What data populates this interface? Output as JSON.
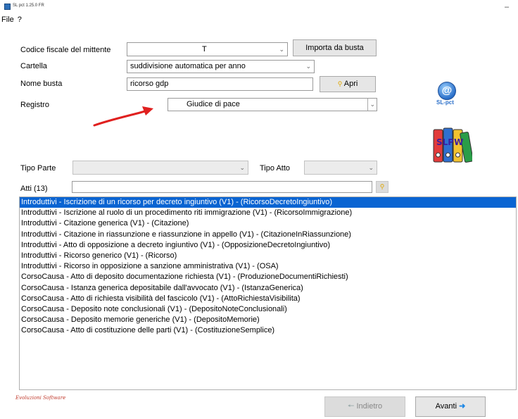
{
  "window": {
    "title": "SL pct 1.25.0 FR",
    "minimize": "–"
  },
  "menu": {
    "file": "File",
    "help": "?"
  },
  "form": {
    "codice_fiscale_label": "Codice fiscale del mittente",
    "codice_fiscale_value": "T",
    "importa_button": "Importa da busta",
    "cartella_label": "Cartella",
    "cartella_value": "suddivisione automatica per anno",
    "nome_busta_label": "Nome busta",
    "nome_busta_value": "ricorso gdp",
    "apri_button": "Apri",
    "registro_label": "Registro",
    "registro_value": "Giudice di pace",
    "tipo_parte_label": "Tipo Parte",
    "tipo_atto_label": "Tipo Atto",
    "atti_label": "Atti (13)"
  },
  "logos": {
    "slpct_at": "@",
    "slpct_text": "SL-pct",
    "binders_text": "SLPW"
  },
  "icons": {
    "chevron": "chevron-down-icon",
    "search": "search-icon",
    "arrow": "red-arrow",
    "back": "arrow-left-icon",
    "next": "arrow-right-icon"
  },
  "colors": {
    "selection": "#0a64d2",
    "arrow": "#e0201f",
    "brand": "#c0392b",
    "next_arrow": "#1e88e5"
  },
  "atti": [
    "Introduttivi - Iscrizione di un ricorso per decreto ingiuntivo (V1) - (RicorsoDecretoIngiuntivo)",
    "Introduttivi - Iscrizione al ruolo di un procedimento riti immigrazione (V1) - (RicorsoImmigrazione)",
    "Introduttivi - Citazione generica (V1) - (Citazione)",
    "Introduttivi - Citazione in riassunzione e riassunzione in appello (V1) - (CitazioneInRiassunzione)",
    "Introduttivi - Atto di opposizione a decreto ingiuntivo (V1) - (OpposizioneDecretoIngiuntivo)",
    "Introduttivi - Ricorso generico (V1) - (Ricorso)",
    "Introduttivi - Ricorso in opposizione a sanzione amministrativa (V1) - (OSA)",
    "CorsoCausa - Atto di deposito documentazione richiesta (V1) - (ProduzioneDocumentiRichiesti)",
    "CorsoCausa - Istanza generica depositabile dall'avvocato (V1) - (IstanzaGenerica)",
    "CorsoCausa - Atto di richiesta visibilità del fascicolo (V1) - (AttoRichiestaVisibilita)",
    "CorsoCausa - Deposito note conclusionali (V1) - (DepositoNoteConclusionali)",
    "CorsoCausa - Deposito memorie generiche (V1) - (DepositoMemorie)",
    "CorsoCausa - Atto di costituzione delle parti (V1) - (CostituzioneSemplice)"
  ],
  "selected_index": 0,
  "footer": {
    "brand": "Evoluzioni Software",
    "back_button": "Indietro",
    "next_button": "Avanti"
  }
}
